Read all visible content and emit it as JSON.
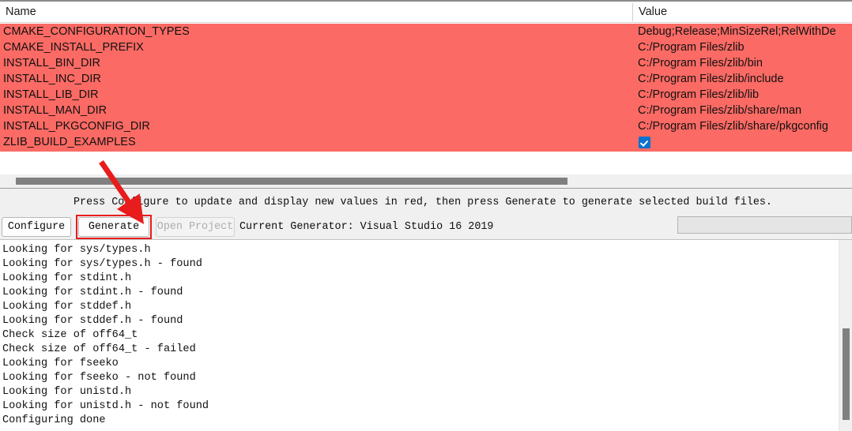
{
  "cache_table": {
    "columns": [
      "Name",
      "Value"
    ],
    "row_highlight_color": "#fb6a64",
    "rows": [
      {
        "name": "CMAKE_CONFIGURATION_TYPES",
        "value": "Debug;Release;MinSizeRel;RelWithDe",
        "type": "text"
      },
      {
        "name": "CMAKE_INSTALL_PREFIX",
        "value": "C:/Program Files/zlib",
        "type": "text"
      },
      {
        "name": "INSTALL_BIN_DIR",
        "value": "C:/Program Files/zlib/bin",
        "type": "text"
      },
      {
        "name": "INSTALL_INC_DIR",
        "value": "C:/Program Files/zlib/include",
        "type": "text"
      },
      {
        "name": "INSTALL_LIB_DIR",
        "value": "C:/Program Files/zlib/lib",
        "type": "text"
      },
      {
        "name": "INSTALL_MAN_DIR",
        "value": "C:/Program Files/zlib/share/man",
        "type": "text"
      },
      {
        "name": "INSTALL_PKGCONFIG_DIR",
        "value": "C:/Program Files/zlib/share/pkgconfig",
        "type": "text"
      },
      {
        "name": "ZLIB_BUILD_EXAMPLES",
        "value": "",
        "type": "checkbox",
        "checked": true
      }
    ]
  },
  "control_bar": {
    "hint": "Press Configure to update and display new values in red, then press Generate to generate selected build files.",
    "configure_label": "Configure",
    "generate_label": "Generate",
    "open_project_label": "Open Project",
    "current_generator": "Current Generator: Visual Studio 16 2019",
    "generate_highlight_color": "#e81c1c",
    "progress_value": ""
  },
  "output": {
    "lines": [
      "Looking for sys/types.h",
      "Looking for sys/types.h - found",
      "Looking for stdint.h",
      "Looking for stdint.h - found",
      "Looking for stddef.h",
      "Looking for stddef.h - found",
      "Check size of off64_t",
      "Check size of off64_t - failed",
      "Looking for fseeko",
      "Looking for fseeko - not found",
      "Looking for unistd.h",
      "Looking for unistd.h - not found",
      "Configuring done"
    ]
  },
  "annotation": {
    "arrow_color": "#e81c1c"
  }
}
